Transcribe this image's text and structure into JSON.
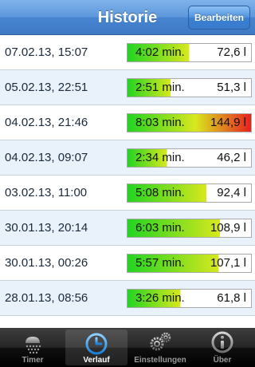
{
  "navbar": {
    "title": "Historie",
    "edit_label": "Bearbeiten"
  },
  "history": [
    {
      "date": "07.02.13, 15:07",
      "duration": "4:02 min.",
      "volume": "72,6 l",
      "fill": 0.5
    },
    {
      "date": "05.02.13, 22:51",
      "duration": "2:51 min.",
      "volume": "51,3 l",
      "fill": 0.35
    },
    {
      "date": "04.02.13, 21:46",
      "duration": "8:03 min.",
      "volume": "144,9 l",
      "fill": 1.0
    },
    {
      "date": "04.02.13, 09:07",
      "duration": "2:34 min.",
      "volume": "46,2 l",
      "fill": 0.32
    },
    {
      "date": "03.02.13, 11:00",
      "duration": "5:08 min.",
      "volume": "92,4 l",
      "fill": 0.64
    },
    {
      "date": "30.01.13, 20:14",
      "duration": "6:03 min.",
      "volume": "108,9 l",
      "fill": 0.75
    },
    {
      "date": "30.01.13, 00:26",
      "duration": "5:57 min.",
      "volume": "107,1 l",
      "fill": 0.74
    },
    {
      "date": "28.01.13, 08:56",
      "duration": "3:26 min.",
      "volume": "61,8 l",
      "fill": 0.43
    }
  ],
  "partial_row_fill": 0.55,
  "colors": {
    "bar_start": "#22d422",
    "bar_mid": "#d8e81e",
    "bar_end": "#e82020",
    "bar_empty": "#ffffff"
  },
  "tabs": [
    {
      "label": "Timer",
      "icon": "shower-icon",
      "active": false
    },
    {
      "label": "Verlauf",
      "icon": "clock-icon",
      "active": true
    },
    {
      "label": "Einstellungen",
      "icon": "gears-icon",
      "active": false
    },
    {
      "label": "Über",
      "icon": "info-icon",
      "active": false
    }
  ]
}
